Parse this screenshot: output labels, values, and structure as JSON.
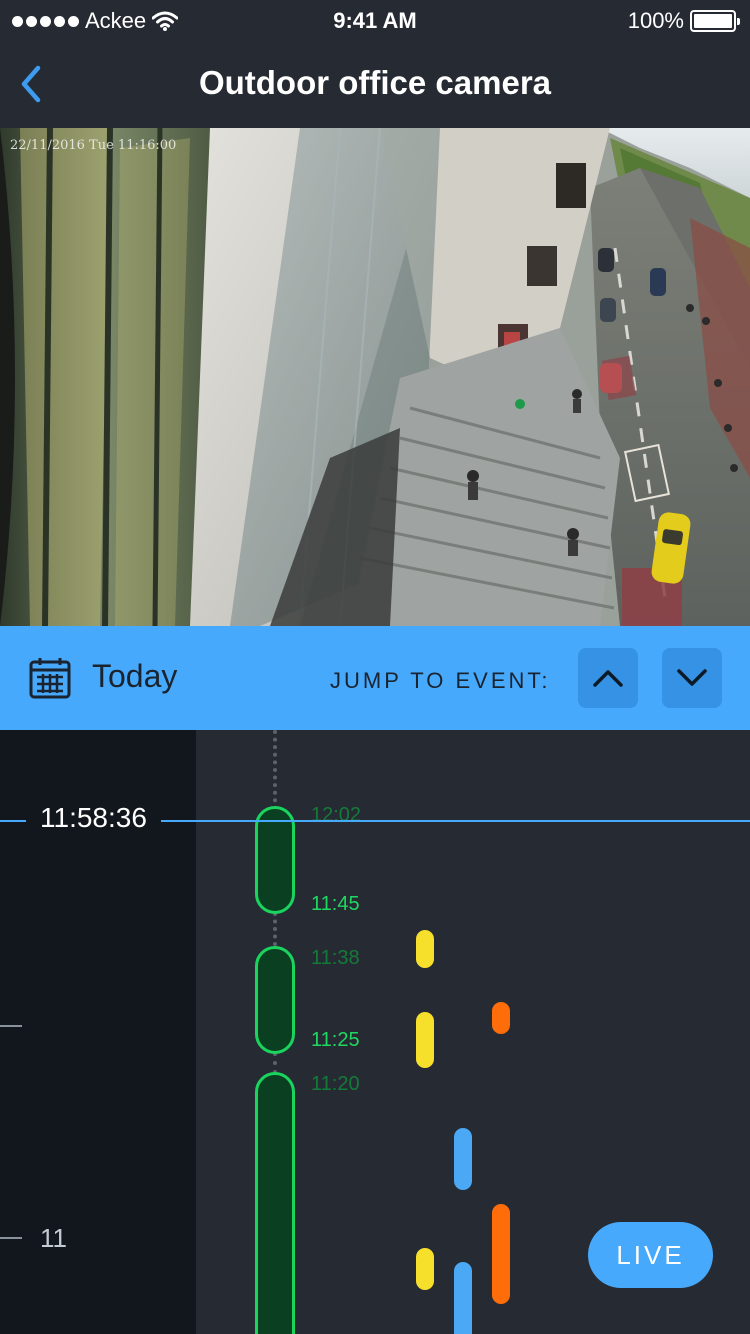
{
  "status_bar": {
    "carrier": "Ackee",
    "time": "9:41 AM",
    "battery": "100%",
    "battery_level": 1.0
  },
  "nav": {
    "title": "Outdoor office camera",
    "back_icon": "chevron-left-icon"
  },
  "camera": {
    "timestamp": "22/11/2016 Tue 11:16:00"
  },
  "event_bar": {
    "date_label": "Today",
    "calendar_icon": "calendar-icon",
    "jump_label": "JUMP TO EVENT:",
    "prev_icon": "chevron-up-icon",
    "next_icon": "chevron-down-icon"
  },
  "timeline": {
    "current_time": "11:58:36",
    "hour_label": "11",
    "recordings": [
      {
        "start_label": "12:02",
        "end_label": "11:45"
      },
      {
        "start_label": "11:38",
        "end_label": "11:25"
      },
      {
        "start_label": "11:20"
      }
    ],
    "event_colors": {
      "yellow": "#f7e02b",
      "orange": "#ff6d0a",
      "blue": "#4aa8f5"
    },
    "live_label": "LIVE"
  },
  "colors": {
    "accent": "#47a9fb",
    "background": "#262b33",
    "recording_green": "#19d45d"
  }
}
